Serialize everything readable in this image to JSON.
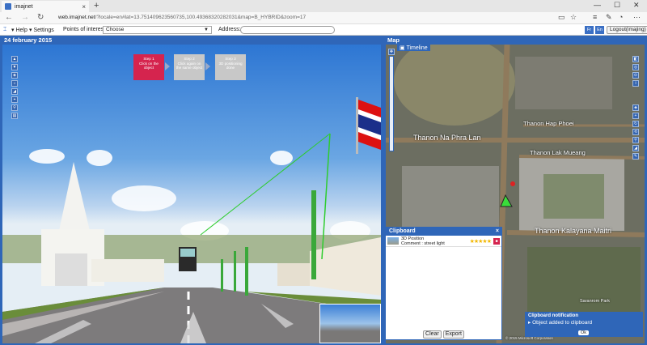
{
  "browser": {
    "tab_title": "imajnet",
    "tab_close": "×",
    "new_tab": "+",
    "url_host": "web.imajnet.net",
    "url_path": "/?locale=en#lat=13.751409623560735,100.49368320282031&map=B_HYBRID&zoom=17",
    "min": "—",
    "max": "☐",
    "close": "✕"
  },
  "toolbar": {
    "help": "Help",
    "settings": "Settings",
    "poi_label": "Points of interest:",
    "poi_value": "Choose",
    "address_label": "Address:",
    "address_value": "",
    "lang_fr": "Fr",
    "lang_en": "En",
    "logout": "Logout(imajing)"
  },
  "photo_panel": {
    "title": "24 february 2015",
    "steps": [
      {
        "label": "Step 1\nClick on the\nobject"
      },
      {
        "label": "Step 2\nClick again on\nthe same object"
      },
      {
        "label": "Step 3\n3D positioning\ndone"
      }
    ]
  },
  "map_panel": {
    "title": "Map",
    "timeline": "Timeline",
    "labels": {
      "hap_phoei": "Thanon Hap Phoei",
      "phra_lan": "Thanon Na Phra Lan",
      "lak_mueang": "Thanon Lak Mueang",
      "kalayana": "Thanon Kalayana Maitri",
      "saranrom": "Saranrom Park",
      "copyright": "© 2015 Microsoft Corporation"
    }
  },
  "clipboard": {
    "title": "Clipboard",
    "close": "×",
    "items": [
      {
        "name": "3D Position",
        "comment": "Comment : street light",
        "stars": "★★★★★"
      }
    ],
    "clear": "Clear",
    "export": "Export"
  },
  "notification": {
    "title": "Clipboard notification",
    "message": "Object added to clipboard",
    "ok": "Ok"
  },
  "colors": {
    "panel_blue": "#2f66b8",
    "step_active": "#d5244e"
  }
}
